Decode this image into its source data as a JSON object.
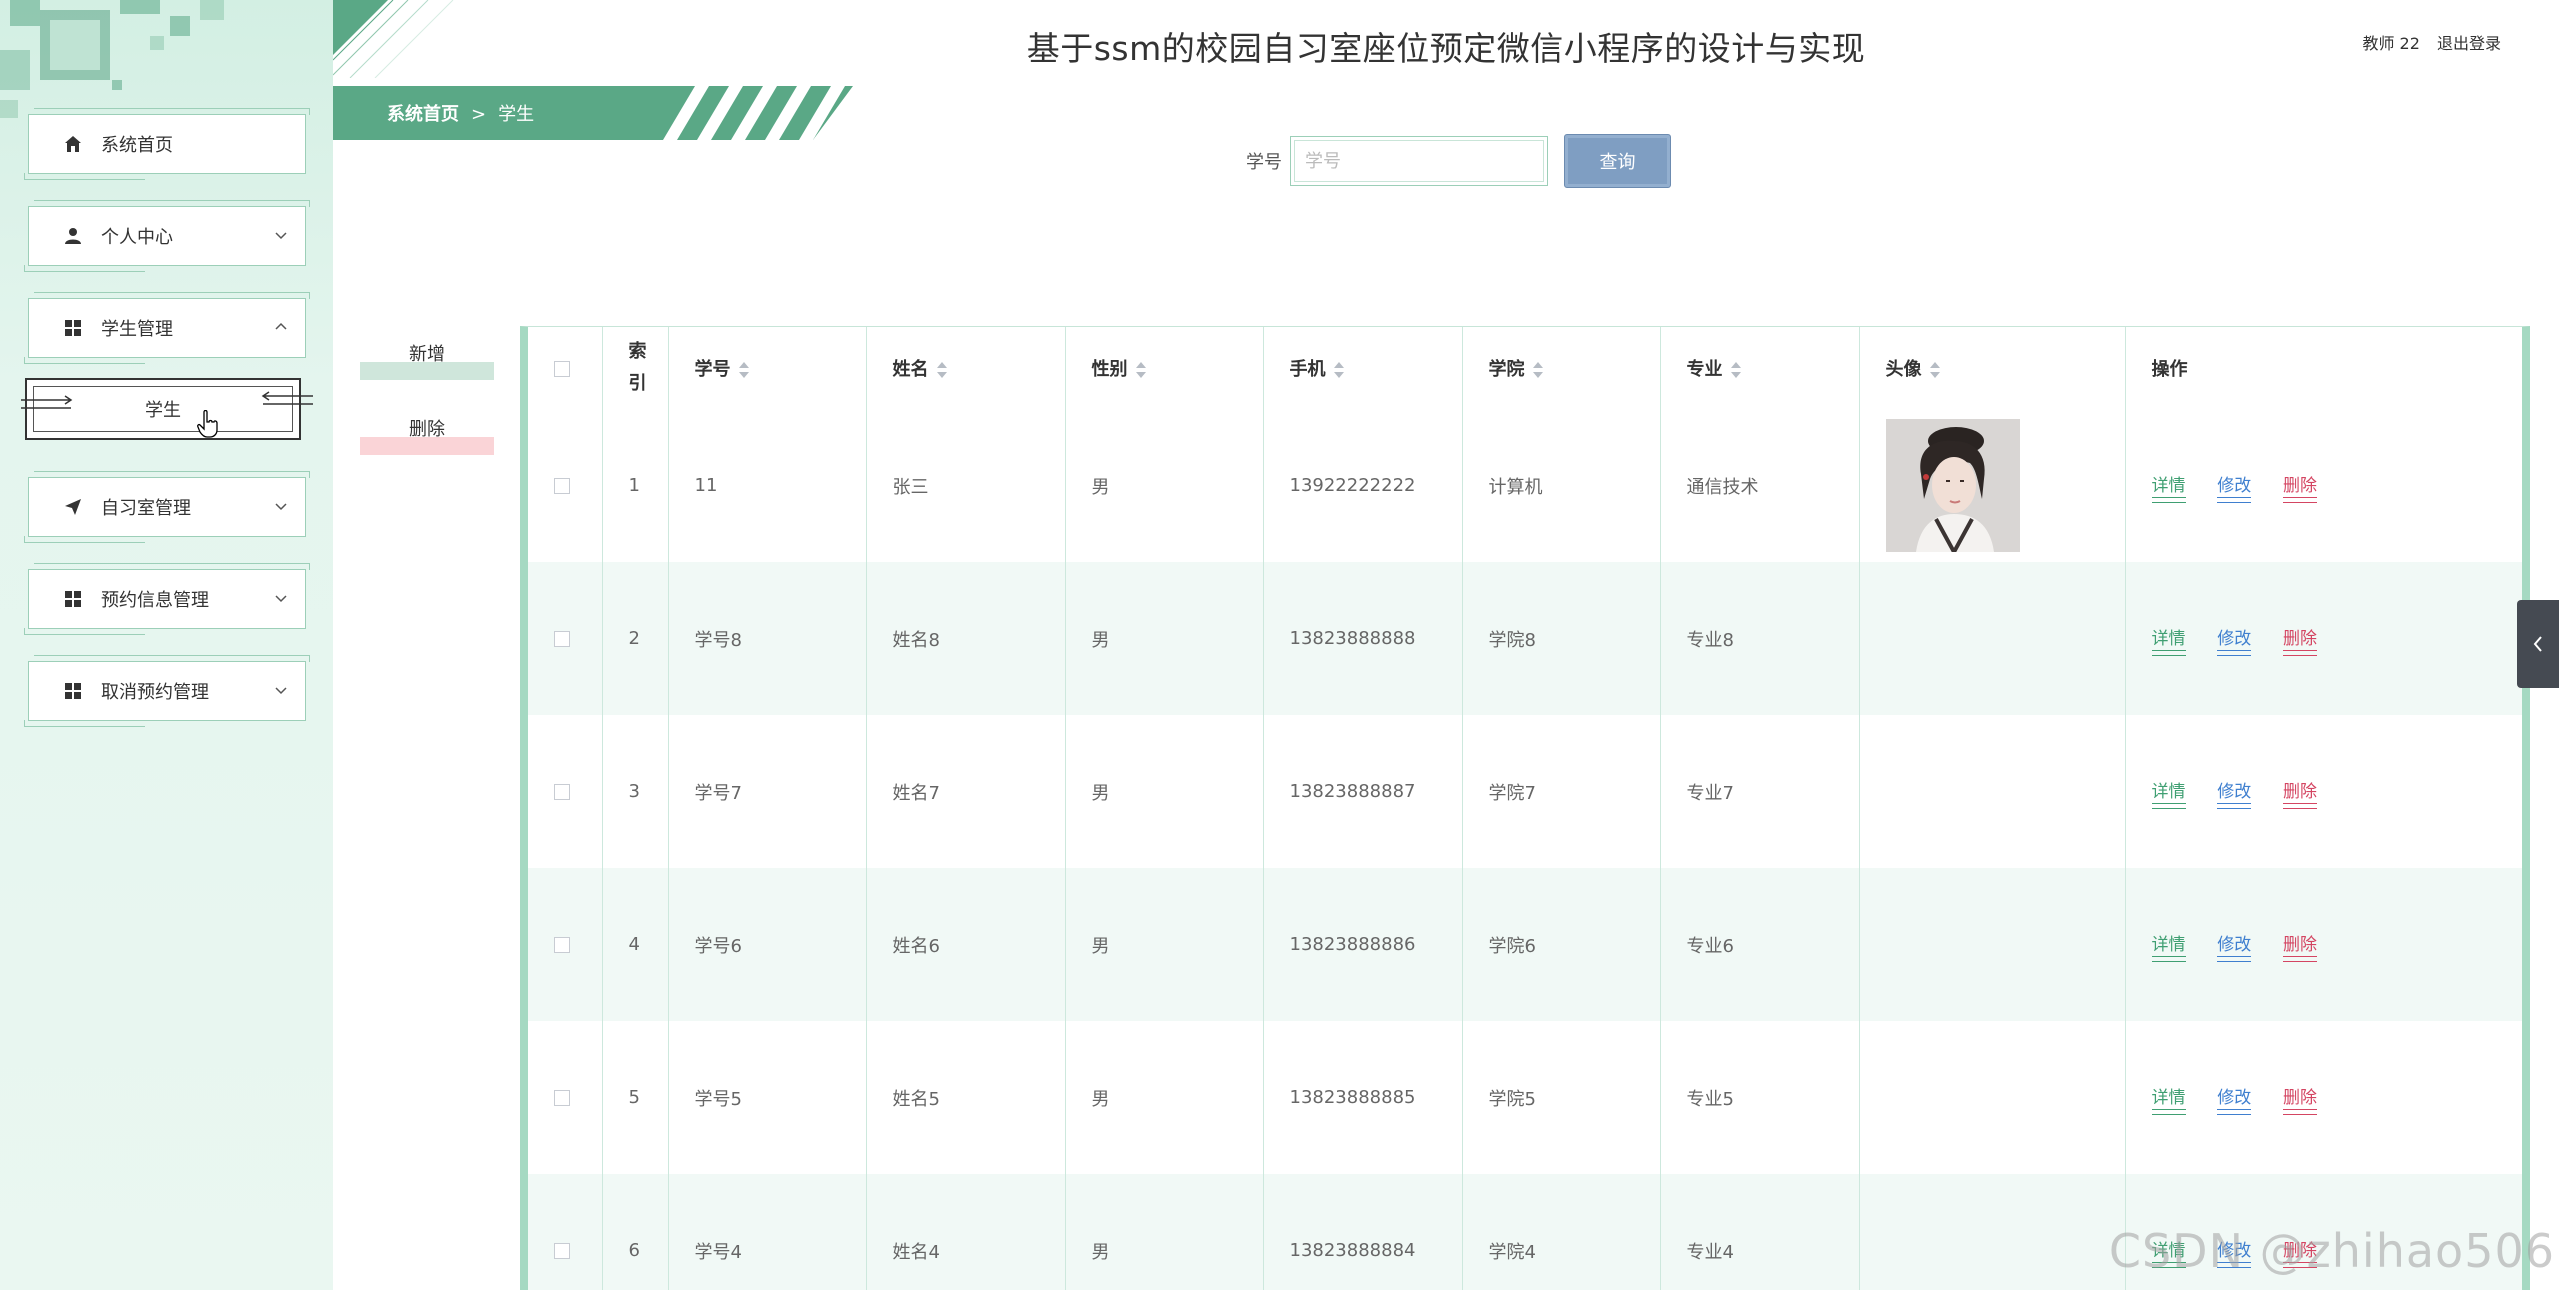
{
  "header": {
    "title": "基于ssm的校园自习室座位预定微信小程序的设计与实现",
    "user": "教师 22",
    "logout": "退出登录"
  },
  "breadcrumb": {
    "home": "系统首页",
    "sep": ">",
    "current": "学生"
  },
  "sidebar": {
    "items": [
      {
        "label": "系统首页",
        "icon": "home-icon"
      },
      {
        "label": "个人中心",
        "icon": "user-icon"
      },
      {
        "label": "学生管理",
        "icon": "grid-icon",
        "sub": "学生"
      },
      {
        "label": "自习室管理",
        "icon": "send-icon"
      },
      {
        "label": "预约信息管理",
        "icon": "grid-icon"
      },
      {
        "label": "取消预约管理",
        "icon": "grid-icon"
      }
    ]
  },
  "search": {
    "label": "学号",
    "placeholder": "学号",
    "button": "查询"
  },
  "actions": {
    "add": "新增",
    "delete": "删除"
  },
  "table": {
    "headers": {
      "index": "索引",
      "student_no": "学号",
      "name": "姓名",
      "gender": "性别",
      "phone": "手机",
      "college": "学院",
      "major": "专业",
      "avatar": "头像",
      "ops": "操作"
    },
    "ops": {
      "detail": "详情",
      "edit": "修改",
      "remove": "删除"
    },
    "rows": [
      {
        "index": "1",
        "student_no": "11",
        "name": "张三",
        "gender": "男",
        "phone": "13922222222",
        "college": "计算机",
        "major": "通信技术"
      },
      {
        "index": "2",
        "student_no": "学号8",
        "name": "姓名8",
        "gender": "男",
        "phone": "13823888888",
        "college": "学院8",
        "major": "专业8"
      },
      {
        "index": "3",
        "student_no": "学号7",
        "name": "姓名7",
        "gender": "男",
        "phone": "13823888887",
        "college": "学院7",
        "major": "专业7"
      },
      {
        "index": "4",
        "student_no": "学号6",
        "name": "姓名6",
        "gender": "男",
        "phone": "13823888886",
        "college": "学院6",
        "major": "专业6"
      },
      {
        "index": "5",
        "student_no": "学号5",
        "name": "姓名5",
        "gender": "男",
        "phone": "13823888885",
        "college": "学院5",
        "major": "专业5"
      },
      {
        "index": "6",
        "student_no": "学号4",
        "name": "姓名4",
        "gender": "男",
        "phone": "13823888884",
        "college": "学院4",
        "major": "专业4"
      }
    ]
  },
  "watermark": "CSDN @zhihao506",
  "colors": {
    "accent": "#5aa886",
    "button": "#7f9ec2",
    "detail": "#3f9f72",
    "edit": "#3f7fcf",
    "remove": "#d44562"
  }
}
